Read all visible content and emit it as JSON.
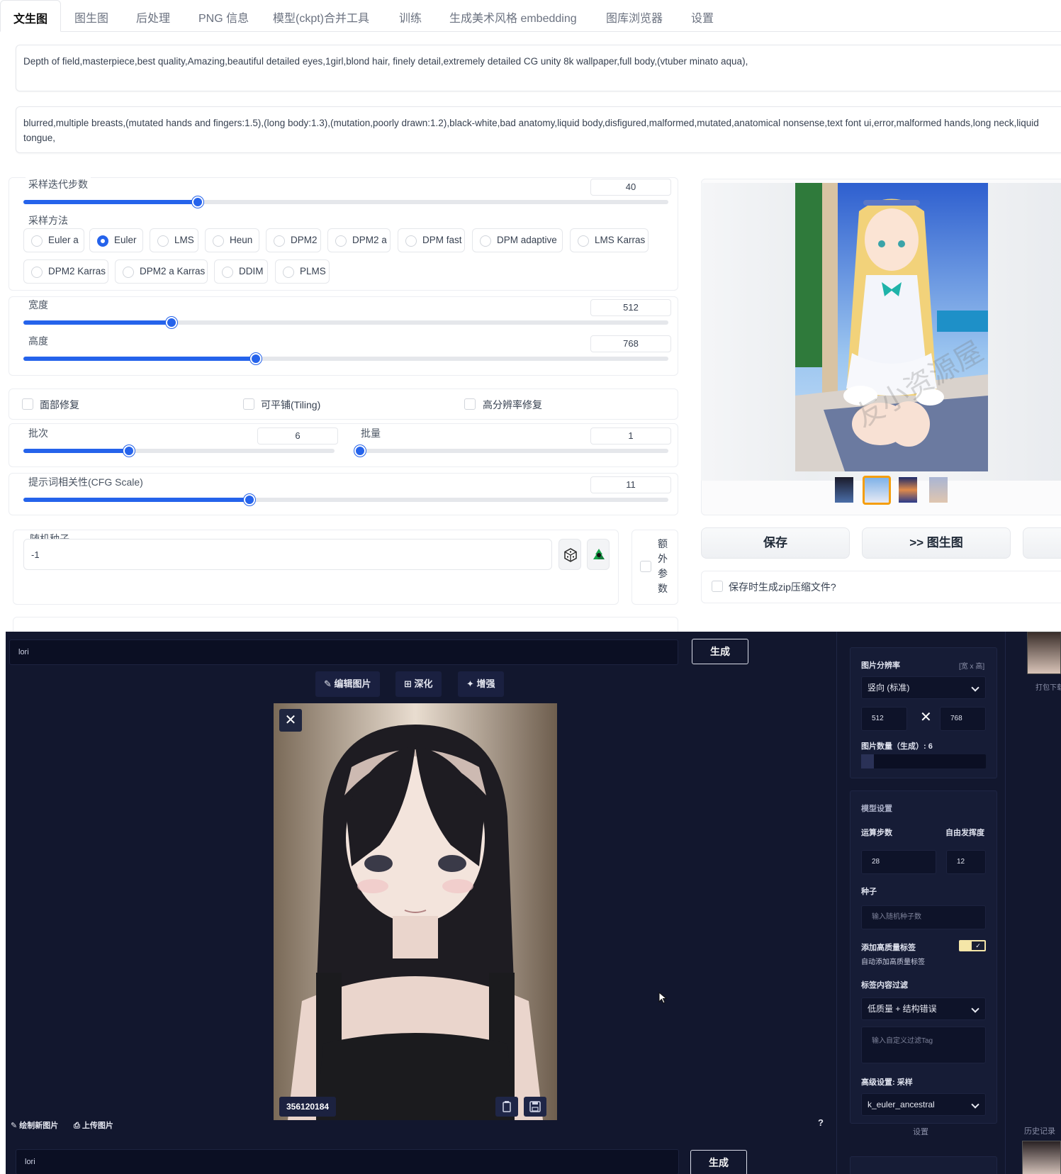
{
  "top": {
    "tabs": [
      "文生图",
      "图生图",
      "后处理",
      "PNG 信息",
      "模型(ckpt)合并工具",
      "训练",
      "生成美术风格 embedding",
      "图库浏览器",
      "设置"
    ],
    "prompt": "Depth of field,masterpiece,best quality,Amazing,beautiful detailed eyes,1girl,blond hair, finely detail,extremely detailed CG unity 8k wallpaper,full body,(vtuber minato aqua),",
    "negative_prompt": "blurred,multiple breasts,(mutated hands and fingers:1.5),(long body:1.3),(mutation,poorly drawn:1.2),black-white,bad anatomy,liquid body,disfigured,malformed,mutated,anatomical nonsense,text font ui,error,malformed hands,long neck,liquid tongue,",
    "steps": {
      "label": "采样迭代步数",
      "value": "40",
      "fraction": 0.27
    },
    "sampler": {
      "label": "采样方法",
      "options": [
        "Euler a",
        "Euler",
        "LMS",
        "Heun",
        "DPM2",
        "DPM2 a",
        "DPM fast",
        "DPM adaptive",
        "LMS Karras",
        "DPM2 Karras",
        "DPM2 a Karras",
        "DDIM",
        "PLMS"
      ],
      "selected": "Euler"
    },
    "width": {
      "label": "宽度",
      "value": "512",
      "fraction": 0.23
    },
    "height": {
      "label": "高度",
      "value": "768",
      "fraction": 0.36
    },
    "checkboxes": {
      "face": "面部修复",
      "tiling": "可平铺(Tiling)",
      "hires": "高分辨率修复"
    },
    "batch_count": {
      "label": "批次",
      "value": "6",
      "fraction": 0.34
    },
    "batch_size": {
      "label": "批量",
      "value": "1",
      "fraction": 0.0
    },
    "cfg": {
      "label": "提示词相关性(CFG Scale)",
      "value": "11",
      "fraction": 0.35
    },
    "seed": {
      "label": "随机种子",
      "value": "-1"
    },
    "extra": "额外参数",
    "buttons": {
      "save": "保存",
      "to_img2img": ">> 图生图"
    },
    "zip_checkbox": "保存时生成zip压缩文件?",
    "watermark": "友小资源屋",
    "colors": {
      "accent": "#2563eb"
    }
  },
  "bottom": {
    "prompt": "lori",
    "generate": "生成",
    "tools": {
      "edit": "编辑图片",
      "deepen": "深化",
      "enhance": "增强"
    },
    "seed_badge": "356120184",
    "bottom_left": {
      "draw": "绘制新图片",
      "upload": "上传图片"
    },
    "help": "?",
    "prompt2": "lori",
    "generate2": "生成",
    "settings": {
      "resolution_label": "图片分辨率",
      "resolution_hint": "[宽 x 高]",
      "orientation": "竖向 (标准)",
      "w": "512",
      "h": "768",
      "times": "✕",
      "count_label": "图片数量（生成）: 6",
      "count_fraction": 0.1,
      "model_label": "模型设置",
      "steps_label": "运算步数",
      "scale_label": "自由发挥度",
      "steps": "28",
      "scale": "12",
      "seed_label": "种子",
      "seed_placeholder": "输入随机种子数",
      "quality_label": "添加高质量标签",
      "quality_desc": "自动添加高质量标签",
      "filter_label": "标签内容过滤",
      "filter_value": "低质量 + 结构错误",
      "filter_placeholder": "输入自定义过滤Tag",
      "advanced_label": "高级设置: 采样",
      "sampler_value": "k_euler_ancestral",
      "settings_link": "设置",
      "history": "历史记录",
      "pack_download": "打包下载",
      "accent": "#f5e6a8"
    }
  }
}
